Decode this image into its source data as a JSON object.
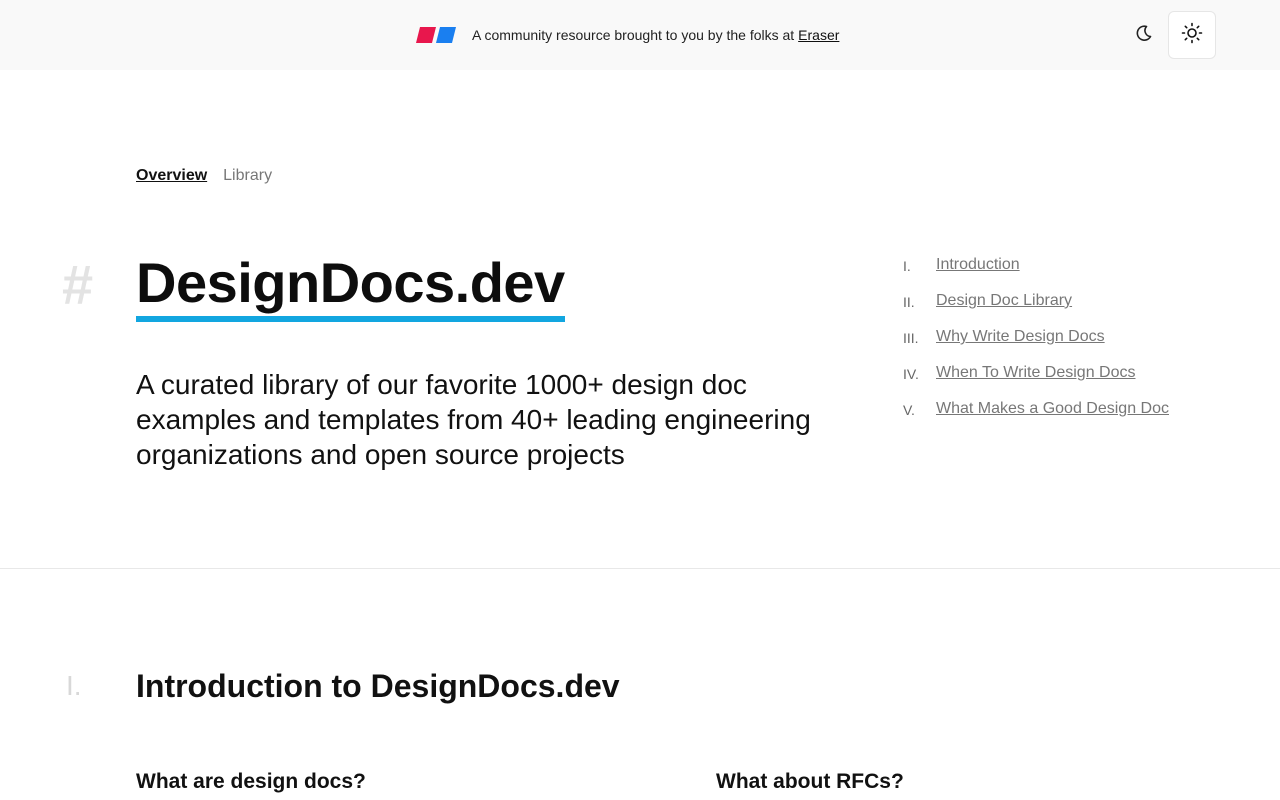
{
  "banner": {
    "text": "A community resource brought to you by the folks at",
    "link_label": "Eraser",
    "logo_colors": [
      "#e8174d",
      "#1a7ff0"
    ]
  },
  "theme_controls": {
    "dark_icon": "moon-icon",
    "light_icon": "sun-icon"
  },
  "tabs": [
    {
      "label": "Overview",
      "active": true
    },
    {
      "label": "Library",
      "active": false
    }
  ],
  "hero": {
    "hash_mark": "#",
    "title": "DesignDocs.dev",
    "subtitle": "A curated library of our favorite 1000+ design doc examples and templates from 40+ leading engineering organizations and open source projects",
    "accent_color": "#12a6e0"
  },
  "toc": [
    {
      "num": "I.",
      "label": "Introduction"
    },
    {
      "num": "II.",
      "label": "Design Doc Library"
    },
    {
      "num": "III.",
      "label": "Why Write Design Docs"
    },
    {
      "num": "IV.",
      "label": "When To Write Design Docs"
    },
    {
      "num": "V.",
      "label": "What Makes a Good Design Doc"
    }
  ],
  "section": {
    "num": "I.",
    "title": "Introduction to DesignDocs.dev",
    "sub_left": "What are design docs?",
    "sub_right": "What about RFCs?"
  }
}
